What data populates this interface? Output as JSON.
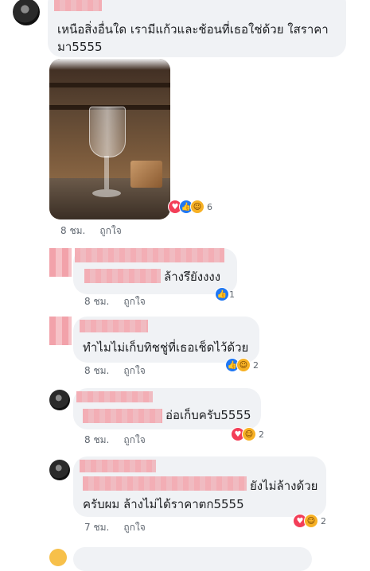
{
  "comments": [
    {
      "text_lines": [
        "เหนือสิ่งอื่นใด เรามีแก้วและช้อนที่เธอใช่ด้วย ใสราคา",
        "มา5555"
      ],
      "time": "8 ชม.",
      "like": "ถูกใจ",
      "reactions": {
        "icons": [
          "love-icon",
          "like-icon",
          "haha-icon"
        ],
        "count": "6"
      }
    },
    {
      "text": "ล้างรึยังงงง",
      "time": "8 ชม.",
      "like": "ถูกใจ",
      "reactions": {
        "icons": [
          "like-icon"
        ],
        "count": "1"
      }
    },
    {
      "text": "ทำไมไม่เก็บทิชชู่ที่เธอเช็ดไว้ด้วย",
      "time": "8 ชม.",
      "like": "ถูกใจ",
      "reactions": {
        "icons": [
          "like-icon",
          "haha-icon"
        ],
        "count": "2"
      }
    },
    {
      "text": "อ่อเก็บครับ5555",
      "time": "8 ชม.",
      "like": "ถูกใจ",
      "reactions": {
        "icons": [
          "love-icon",
          "haha-icon"
        ],
        "count": "2"
      }
    },
    {
      "text_lines": [
        "ยังไม่ล้างด้วย",
        "ครับผม ล้างไม่ได้ราคาตก5555"
      ],
      "time": "7 ชม.",
      "like": "ถูกใจ",
      "reactions": {
        "icons": [
          "love-icon",
          "haha-icon"
        ],
        "count": "2"
      }
    }
  ],
  "colors": {
    "bubble": "#f0f2f5",
    "like": "#2078f4",
    "love": "#f33e58",
    "haha": "#f7b125",
    "redaction": "#f3a6ae"
  }
}
